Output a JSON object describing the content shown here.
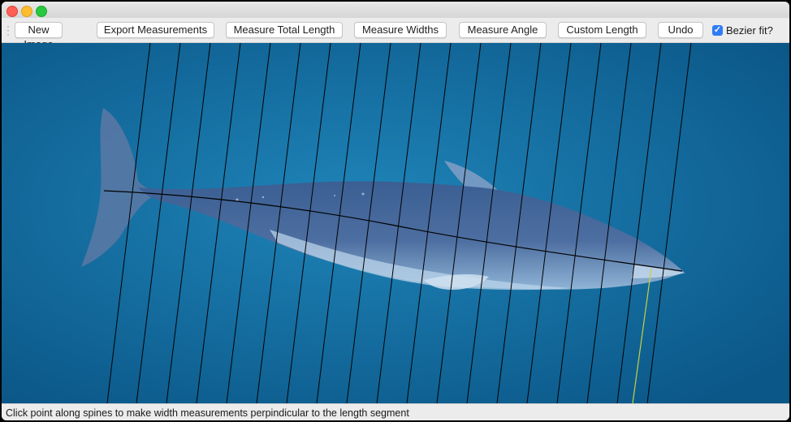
{
  "window": {
    "title": ""
  },
  "toolbar": {
    "new_image_label": "New Image",
    "export_label": "Export Measurements",
    "total_length_label": "Measure Total Length",
    "widths_label": "Measure Widths",
    "angle_label": "Measure Angle",
    "custom_length_label": "Custom Length",
    "undo_label": "Undo",
    "bezier_label": "Bezier fit?",
    "bezier_checked": true
  },
  "canvas": {
    "subject": "whale-photo",
    "line_color": "#000000",
    "guide_color": "#c8d040",
    "water_color": "#136da3"
  },
  "status": {
    "message": "Click point along spines to make width measurements perpindicular to the length segment"
  }
}
